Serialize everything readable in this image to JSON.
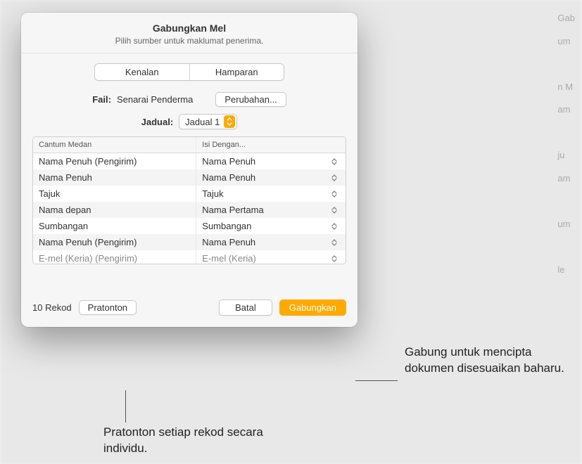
{
  "dialog": {
    "title": "Gabungkan Mel",
    "subtitle": "Pilih sumber untuk maklumat penerima.",
    "tabs": {
      "contacts": "Kenalan",
      "spreadsheet": "Hamparan"
    },
    "file_label": "Fail:",
    "file_value": "Senarai Penderma",
    "change_button": "Perubahan...",
    "table_label": "Jadual:",
    "table_selected": "Jadual 1",
    "columns": {
      "merge_field": "Cantum Medan",
      "fill_with": "Isi Dengan..."
    },
    "rows": [
      {
        "field": "Nama Penuh (Pengirim)",
        "fill": "Nama Penuh"
      },
      {
        "field": "Nama Penuh",
        "fill": "Nama Penuh"
      },
      {
        "field": "Tajuk",
        "fill": "Tajuk"
      },
      {
        "field": "Nama depan",
        "fill": "Nama Pertama"
      },
      {
        "field": "Sumbangan",
        "fill": "Sumbangan"
      },
      {
        "field": "Nama Penuh (Pengirim)",
        "fill": "Nama Penuh"
      },
      {
        "field": "E-mel (Keria) (Pengirim)",
        "fill": "E-mel (Keria)"
      }
    ],
    "record_count": "10 Rekod",
    "preview_button": "Pratonton",
    "cancel_button": "Batal",
    "merge_button": "Gabungkan"
  },
  "callouts": {
    "merge": "Gabung untuk mencipta dokumen disesuaikan baharu.",
    "preview": "Pratonton setiap rekod secara individu."
  }
}
